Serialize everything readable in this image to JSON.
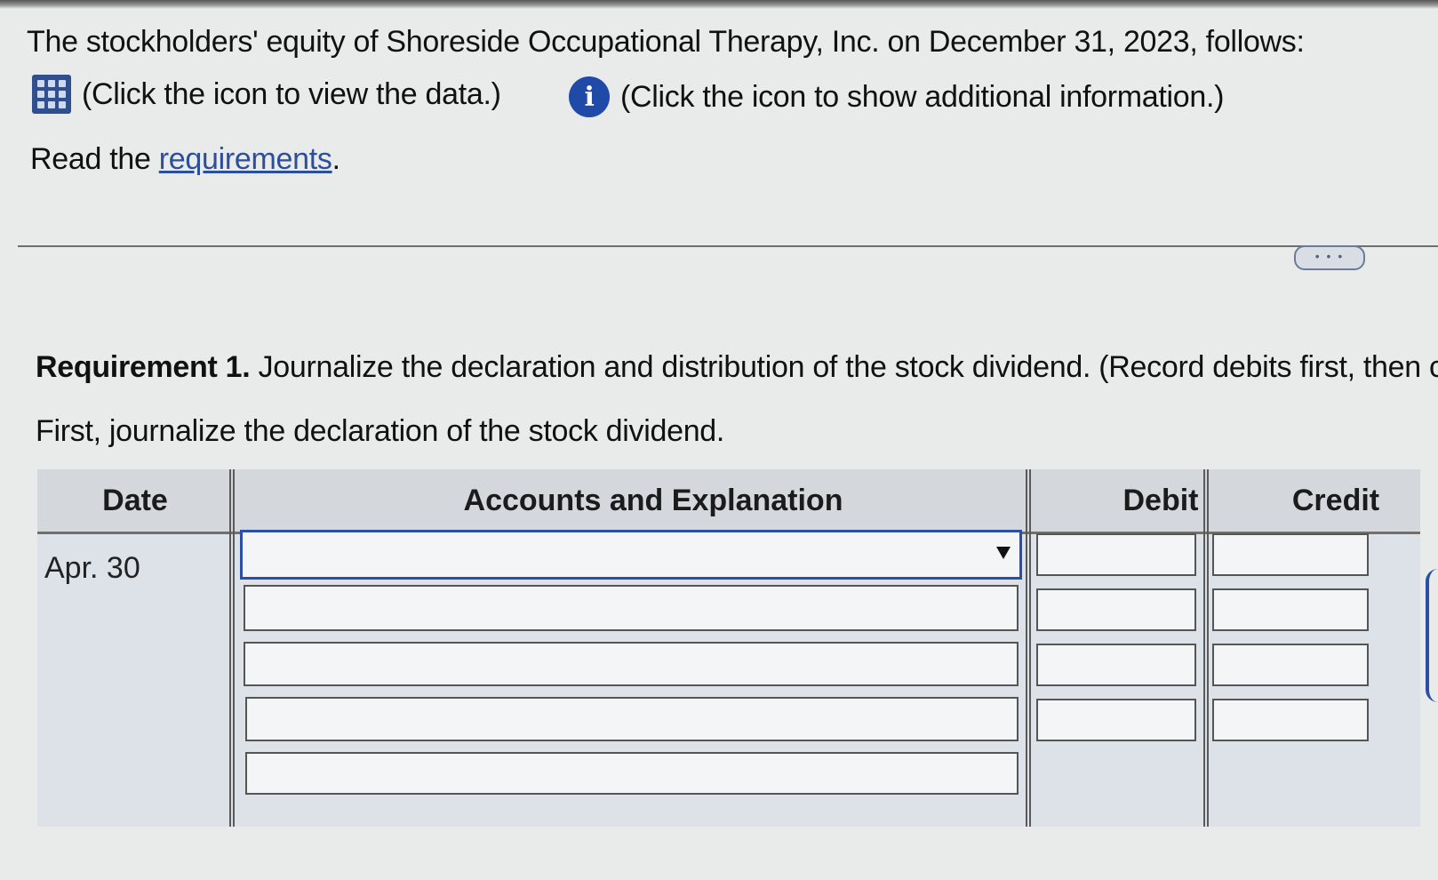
{
  "intro": {
    "text": "The stockholders' equity of Shoreside Occupational Therapy, Inc. on December 31, 2023, follows:",
    "click_data": "(Click the icon to view the data.)",
    "click_info": "(Click the icon to show additional information.)",
    "info_glyph": "i"
  },
  "read": {
    "prefix": "Read the ",
    "link": "requirements",
    "suffix": "."
  },
  "more_button": "• • •",
  "requirement": {
    "label": "Requirement 1.",
    "text": " Journalize the declaration and distribution of the stock dividend. (Record debits first, then cred",
    "first": "First, journalize the declaration of the stock dividend."
  },
  "journal": {
    "headers": {
      "date": "Date",
      "accounts": "Accounts and Explanation",
      "debit": "Debit",
      "credit": "Credit"
    },
    "date": "Apr. 30",
    "rows": [
      {
        "account": "",
        "debit": "",
        "credit": ""
      },
      {
        "account": "",
        "debit": "",
        "credit": ""
      },
      {
        "account": "",
        "debit": "",
        "credit": ""
      },
      {
        "account": "",
        "debit": "",
        "credit": ""
      },
      {
        "account": ""
      }
    ]
  },
  "icons": {
    "data": "data-grid-icon",
    "info": "info-icon",
    "dropdown": "chevron-down-icon"
  },
  "colors": {
    "link": "#2d4f9a",
    "active_border": "#2b4fa8",
    "info_icon": "#1f4aa8",
    "grid_icon": "#2f4f8f"
  }
}
